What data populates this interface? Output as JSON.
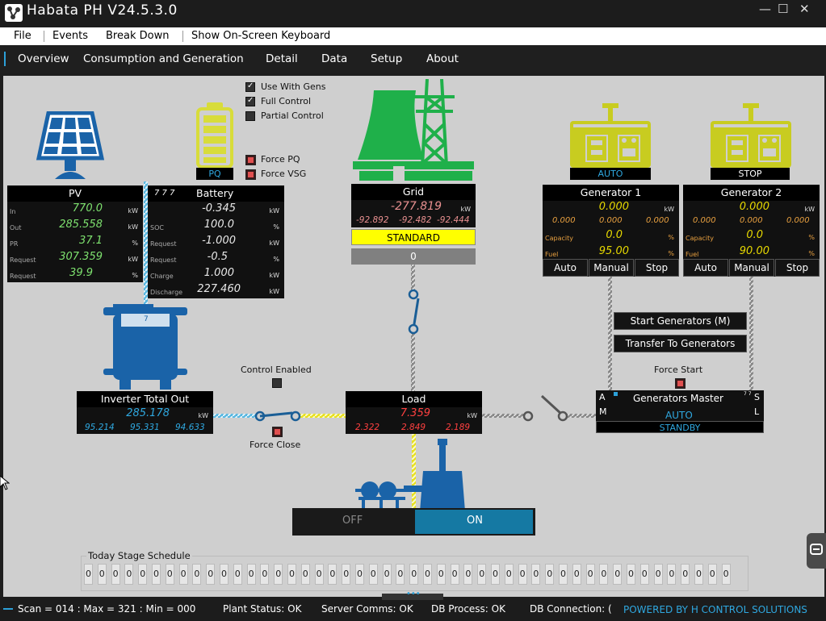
{
  "app": {
    "title": "Habata PH V24.5.3.0"
  },
  "menu": {
    "file": "File",
    "events": "Events",
    "breakdown": "Break Down",
    "keyboard": "Show On-Screen Keyboard"
  },
  "tabs": [
    "Overview",
    "Consumption and Generation",
    "Detail",
    "Data",
    "Setup",
    "About"
  ],
  "options": {
    "use_with_gens": "Use With Gens",
    "full_control": "Full Control",
    "partial_control": "Partial Control",
    "force_pq": "Force PQ",
    "force_vsg": "Force VSG"
  },
  "battery_mode": "PQ",
  "pv": {
    "title": "PV",
    "rows": [
      {
        "label": "In",
        "value": "770.0",
        "unit": "kW"
      },
      {
        "label": "Out",
        "value": "285.558",
        "unit": "kW"
      },
      {
        "label": "PR",
        "value": "37.1",
        "unit": "%"
      },
      {
        "label": "Request",
        "value": "307.359",
        "unit": "kW"
      },
      {
        "label": "Request",
        "value": "39.9",
        "unit": "%"
      }
    ]
  },
  "battery": {
    "title": "Battery",
    "marks": "7   7   7",
    "rows": [
      {
        "label": "",
        "value": "-0.345",
        "unit": "kW"
      },
      {
        "label": "SOC",
        "value": "100.0",
        "unit": "%"
      },
      {
        "label": "Request",
        "value": "-1.000",
        "unit": "kW"
      },
      {
        "label": "Request",
        "value": "-0.5",
        "unit": "%"
      },
      {
        "label": "Charge",
        "value": "1.000",
        "unit": "kW"
      },
      {
        "label": "Discharge",
        "value": "227.460",
        "unit": "kW"
      }
    ]
  },
  "grid": {
    "title": "Grid",
    "value": "-277.819",
    "unit": "kW",
    "phases": [
      "-92.892",
      "-92.482",
      "-92.444"
    ],
    "status": "STANDARD",
    "count": "0"
  },
  "gen1": {
    "status": "AUTO",
    "title": "Generator 1",
    "value": "0.000",
    "unit": "kW",
    "phases": [
      "0.000",
      "0.000",
      "0.000"
    ],
    "capacity_label": "Capacity",
    "capacity": "0.0",
    "fuel_label": "Fuel",
    "fuel": "95.00",
    "pct": "%",
    "buttons": [
      "Auto",
      "Manual",
      "Stop"
    ]
  },
  "gen2": {
    "status": "STOP",
    "title": "Generator 2",
    "value": "0.000",
    "unit": "kW",
    "phases": [
      "0.000",
      "0.000",
      "0.000"
    ],
    "capacity_label": "Capacity",
    "capacity": "0.0",
    "fuel_label": "Fuel",
    "fuel": "90.00",
    "pct": "%",
    "buttons": [
      "Auto",
      "Manual",
      "Stop"
    ]
  },
  "gen_actions": {
    "start": "Start Generators (M)",
    "transfer": "Transfer To Generators",
    "force_start": "Force Start"
  },
  "gen_master": {
    "title": "Generators Master",
    "a": "A",
    "m": "M",
    "s": "S",
    "l": "L",
    "mini": "7 7",
    "mode": "AUTO",
    "state": "STANDBY"
  },
  "inverter": {
    "label": "7",
    "title": "Inverter Total Out",
    "value": "285.178",
    "unit": "kW",
    "phases": [
      "95.214",
      "95.331",
      "94.633"
    ]
  },
  "control": {
    "enabled": "Control Enabled",
    "force_close": "Force Close"
  },
  "load": {
    "title": "Load",
    "value": "7.359",
    "unit": "kW",
    "phases": [
      "2.322",
      "2.849",
      "2.189"
    ]
  },
  "toggle": {
    "off": "OFF",
    "on": "ON"
  },
  "schedule": {
    "title": "Today Stage Schedule",
    "slots": [
      "0",
      "0",
      "0",
      "0",
      "0",
      "0",
      "0",
      "0",
      "0",
      "0",
      "0",
      "0",
      "0",
      "0",
      "0",
      "0",
      "0",
      "0",
      "0",
      "0",
      "0",
      "0",
      "0",
      "0",
      "0",
      "0",
      "0",
      "0",
      "0",
      "0",
      "0",
      "0",
      "0",
      "0",
      "0",
      "0",
      "0",
      "0",
      "0",
      "0",
      "0",
      "0",
      "0",
      "0",
      "0",
      "0",
      "0",
      "0"
    ]
  },
  "status": {
    "scan": "Scan = 014 : Max = 321 : Min = 000",
    "plant": "Plant Status: OK",
    "server": "Server Comms: OK",
    "db_process": "DB Process:  OK",
    "db_conn": "DB Connection: (",
    "powered": "POWERED BY H CONTROL SOLUTIONS"
  },
  "colors": {
    "pv_panel": "#1a63a8",
    "battery": "#d8dc3a",
    "grid": "#1fb04a",
    "generator": "#c8cc20",
    "accent": "#2ca0d8"
  }
}
